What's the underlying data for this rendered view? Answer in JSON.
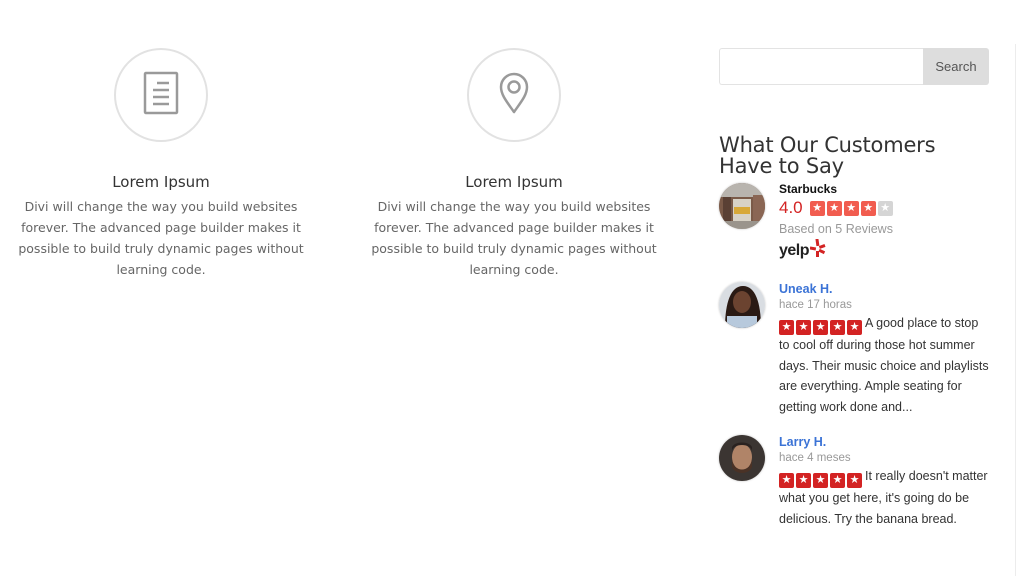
{
  "blurbs": [
    {
      "icon": "document-icon",
      "title": "Lorem Ipsum",
      "text": "Divi will change the way you build websites forever. The advanced page builder makes it possible to build truly dynamic pages without learning code."
    },
    {
      "icon": "map-pin-icon",
      "title": "Lorem Ipsum",
      "text": "Divi will change the way you build websites forever. The advanced page builder makes it possible to build truly dynamic pages without learning code."
    }
  ],
  "sidebar": {
    "search": {
      "value": "",
      "placeholder": "",
      "button_label": "Search"
    },
    "widget_title": "What Our Customers Have to Say",
    "business": {
      "name": "Starbucks",
      "rating": "4.0",
      "stars_filled": 4,
      "stars_total": 5,
      "based_on": "Based on 5 Reviews",
      "logo_text": "yelp"
    },
    "reviews": [
      {
        "name": "Uneak H.",
        "time": "hace 17 horas",
        "stars": 5,
        "text": "A good place to stop to cool off during those hot summer days. Their music choice and playlists are everything. Ample seating for getting work done and..."
      },
      {
        "name": "Larry H.",
        "time": "hace 4 meses",
        "stars": 5,
        "text": "It really doesn't matter what you get here, it's going do be delicious.  Try the banana bread."
      }
    ]
  },
  "colors": {
    "yelp_red": "#d32323",
    "star_filled": "#f15c4f",
    "star_empty": "#d5d5d5",
    "reviewer_link": "#3b73d6"
  }
}
